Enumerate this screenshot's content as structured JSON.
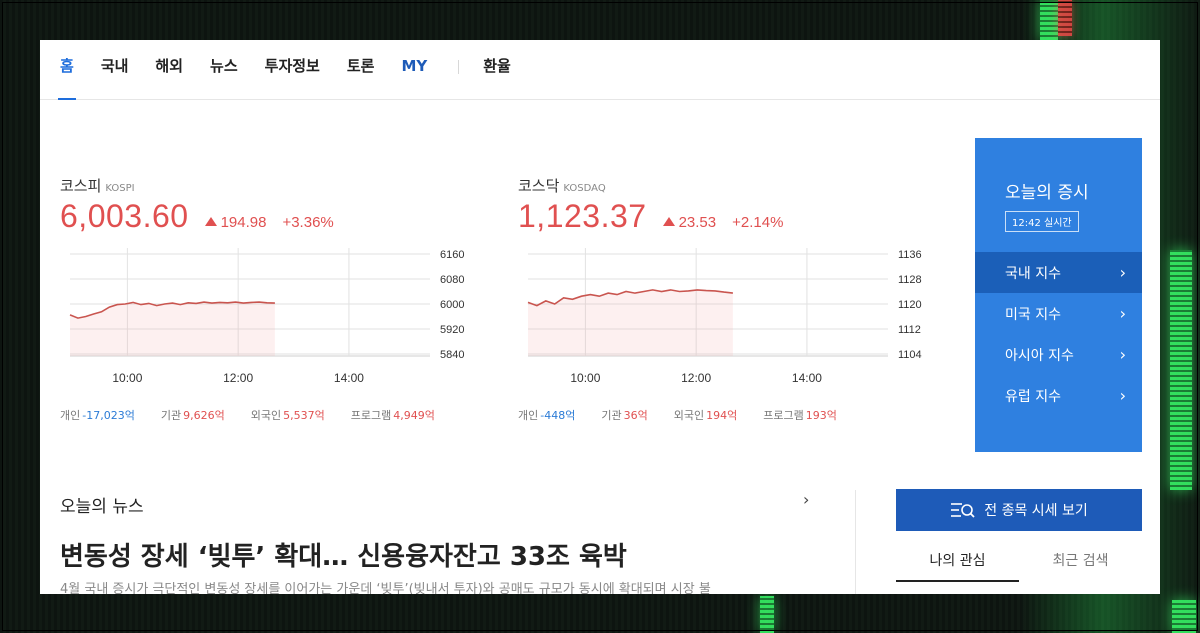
{
  "nav": {
    "items": [
      {
        "label": "홈",
        "active": true
      },
      {
        "label": "국내"
      },
      {
        "label": "해외"
      },
      {
        "label": "뉴스"
      },
      {
        "label": "투자정보"
      },
      {
        "label": "토론"
      },
      {
        "label": "MY"
      }
    ],
    "extra": "환율"
  },
  "kospi": {
    "name": "코스피",
    "name_en": "KOSPI",
    "value": "6,003.60",
    "change": "194.98",
    "change_pct": "+3.36%",
    "flows": [
      {
        "label": "개인",
        "value": "-17,023억",
        "sign": "neg"
      },
      {
        "label": "기관",
        "value": "9,626억",
        "sign": "pos"
      },
      {
        "label": "외국인",
        "value": "5,537억",
        "sign": "pos"
      },
      {
        "label": "프로그램",
        "value": "4,949억",
        "sign": "pos"
      }
    ]
  },
  "kosdaq": {
    "name": "코스닥",
    "name_en": "KOSDAQ",
    "value": "1,123.37",
    "change": "23.53",
    "change_pct": "+2.14%",
    "flows": [
      {
        "label": "개인",
        "value": "-448억",
        "sign": "neg"
      },
      {
        "label": "기관",
        "value": "36억",
        "sign": "pos"
      },
      {
        "label": "외국인",
        "value": "194억",
        "sign": "pos"
      },
      {
        "label": "프로그램",
        "value": "193억",
        "sign": "pos"
      }
    ]
  },
  "chart_data": [
    {
      "type": "area",
      "x_ticks": [
        "10:00",
        "12:00",
        "14:00"
      ],
      "y_ticks": [
        6160,
        6080,
        6000,
        5920,
        5840
      ],
      "ylim": [
        5840,
        6160
      ],
      "series": [
        {
          "values": [
            5965,
            5955,
            5960,
            5968,
            5975,
            5990,
            5998,
            6000,
            6005,
            5998,
            6002,
            5995,
            6000,
            6003,
            5998,
            6004,
            6002,
            6006,
            6003,
            6005,
            6004,
            6006,
            6003,
            6005,
            6006,
            6004,
            6003
          ]
        }
      ]
    },
    {
      "type": "area",
      "x_ticks": [
        "10:00",
        "12:00",
        "14:00"
      ],
      "y_ticks": [
        1136,
        1128,
        1120,
        1112,
        1104
      ],
      "ylim": [
        1104,
        1136
      ],
      "series": [
        {
          "values": [
            1120.5,
            1119.5,
            1121,
            1120,
            1122,
            1121.5,
            1122.5,
            1123,
            1122.5,
            1123.5,
            1123,
            1124,
            1123.5,
            1124,
            1124.5,
            1124,
            1124.5,
            1124,
            1124.2,
            1124.5,
            1124.3,
            1124.2,
            1123.8,
            1123.5
          ]
        }
      ]
    }
  ],
  "market_panel": {
    "title": "오늘의 증시",
    "time": "12:42 실시간",
    "items": [
      "국내 지수",
      "미국 지수",
      "아시아 지수",
      "유럽 지수"
    ]
  },
  "news": {
    "heading": "오늘의 뉴스",
    "title": "변동성 장세 ‘빚투’ 확대… 신용융자잔고 33조 육박",
    "desc": "4월 국내 증시가 극단적인 변동성 장세를 이어가는 가운데 ‘빚투’(빚내서 투자)와 공매도 규모가 동시에 확대되며 시장 불"
  },
  "side": {
    "all_button": "전 종목 시세 보기",
    "tabs": [
      "나의 관심",
      "최근 검색"
    ]
  },
  "colors": {
    "accent": "#1e6ddc",
    "up": "#e05050",
    "down": "#2b7bd6",
    "panel": "#2f80e0"
  }
}
